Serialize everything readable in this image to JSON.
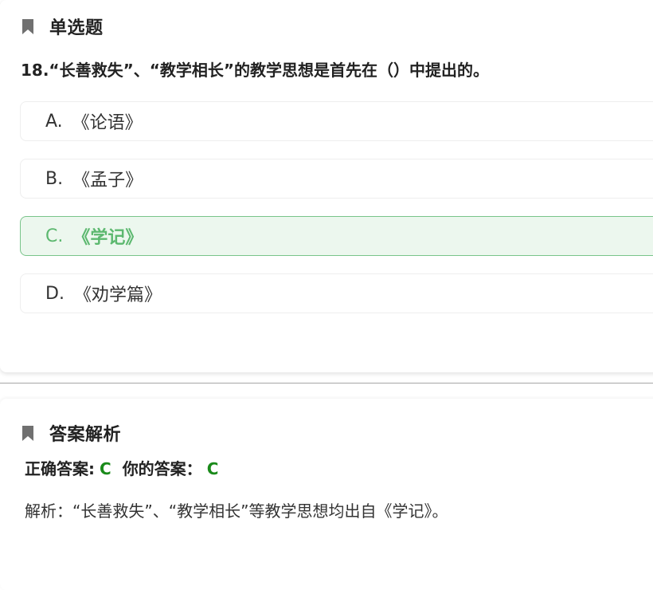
{
  "question_section": {
    "title": "单选题",
    "question_text": "18.“长善救失”、“教学相长”的教学思想是首先在（）中提出的。",
    "options": [
      {
        "letter": "A.",
        "text": "《论语》"
      },
      {
        "letter": "B.",
        "text": "《孟子》"
      },
      {
        "letter": "C.",
        "text": "《学记》",
        "state": "correct"
      },
      {
        "letter": "D.",
        "text": "《劝学篇》"
      }
    ]
  },
  "answer_section": {
    "title": "答案解析",
    "correct_label": "正确答案:",
    "correct_value": "C",
    "your_label": "你的答案：",
    "your_value": "C",
    "analysis_text": "解析：“长善救失”、“教学相长”等教学思想均出自《学记》。"
  },
  "colors": {
    "correct_bg": "#ecf7ee",
    "correct_border": "#79c48a",
    "correct_text": "#5cb86f",
    "answer_value": "#1a8a1a",
    "bookmark_icon": "#707070"
  },
  "icons": {
    "section_icon": "bookmark-icon"
  }
}
